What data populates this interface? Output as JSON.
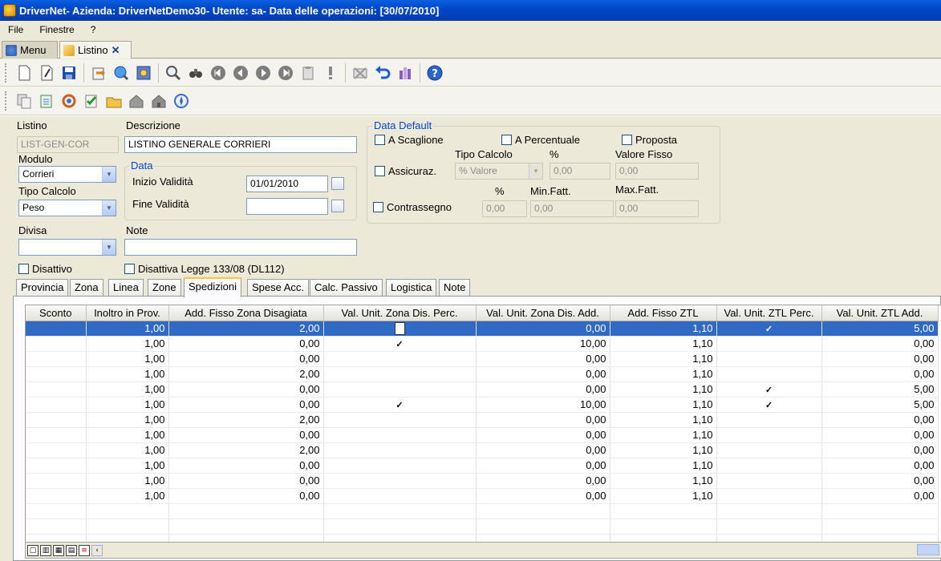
{
  "window": {
    "title": "DriverNet- Azienda: DriverNetDemo30- Utente: sa- Data delle operazioni: [30/07/2010]"
  },
  "menu": [
    "File",
    "Finestre",
    "?"
  ],
  "doc_tabs": [
    {
      "label": "Menu",
      "active": false
    },
    {
      "label": "Listino",
      "active": true
    }
  ],
  "toolbar1_icons": [
    "new-doc-icon",
    "edit-doc-icon",
    "save-icon",
    "import-icon",
    "search-globe-icon",
    "settings-icon",
    "find-icon",
    "binoculars-icon",
    "first-icon",
    "prev-icon",
    "next-icon",
    "last-icon",
    "clipboard-icon",
    "alert-icon",
    "cancel-envelope-icon",
    "undo-icon",
    "bars-icon",
    "help-icon"
  ],
  "toolbar2_icons": [
    "copy-icon",
    "export-icon",
    "refresh-icon",
    "check-list-icon",
    "open-folder-icon",
    "house-icon",
    "house-disabled-icon",
    "compass-icon"
  ],
  "form": {
    "listino_label": "Listino",
    "listino_value": "LIST-GEN-COR",
    "descrizione_label": "Descrizione",
    "descrizione_value": "LISTINO GENERALE CORRIERI",
    "modulo_label": "Modulo",
    "modulo_value": "Corrieri",
    "tipo_calcolo_label": "Tipo Calcolo",
    "tipo_calcolo_value": "Peso",
    "data_group_label": "Data",
    "inizio_validita_label": "Inizio Validità",
    "inizio_validita_value": "01/01/2010",
    "fine_validita_label": "Fine Validità",
    "fine_validita_value": "",
    "divisa_label": "Divisa",
    "divisa_value": "",
    "note_label": "Note",
    "note_value": "",
    "disattivo_label": "Disattivo",
    "disattiva_legge_label": "Disattiva Legge 133/08 (DL112)"
  },
  "data_default": {
    "group_label": "Data Default",
    "a_scaglione_label": "A Scaglione",
    "a_percentuale_label": "A Percentuale",
    "proposta_label": "Proposta",
    "tipo_calcolo_label": "Tipo Calcolo",
    "percent_label": "%",
    "valore_fisso_label": "Valore Fisso",
    "assicuraz_label": "Assicuraz.",
    "assicuraz_tipo_value": "% Valore",
    "assicuraz_percent_value": "0,00",
    "assicuraz_fisso_value": "0,00",
    "percent2_label": "%",
    "min_fatt_label": "Min.Fatt.",
    "max_fatt_label": "Max.Fatt.",
    "contrassegno_label": "Contrassegno",
    "contrassegno_percent_value": "0,00",
    "contrassegno_min_value": "0,00",
    "contrassegno_max_value": "0,00"
  },
  "inner_tabs": [
    "Provincia",
    "Zona",
    "Linea",
    "Zone",
    "Spedizioni",
    "Spese Acc.",
    "Calc. Passivo",
    "Logistica",
    "Note"
  ],
  "active_inner_tab": "Spedizioni",
  "grid": {
    "columns": [
      "Sconto",
      "Inoltro in Prov.",
      "Add. Fisso Zona Disagiata",
      "Val. Unit. Zona Dis. Perc.",
      "Val. Unit. Zona Dis. Add.",
      "Add. Fisso ZTL",
      "Val. Unit. ZTL Perc.",
      "Val. Unit. ZTL Add."
    ],
    "rows": [
      {
        "sconto": "",
        "inoltro": "1,00",
        "add_fisso_zd": "2,00",
        "zd_perc": "box",
        "zd_add": "0,00",
        "add_fisso_ztl": "1,10",
        "ztl_perc": true,
        "ztl_add": "5,00"
      },
      {
        "sconto": "",
        "inoltro": "1,00",
        "add_fisso_zd": "0,00",
        "zd_perc": true,
        "zd_add": "10,00",
        "add_fisso_ztl": "1,10",
        "ztl_perc": false,
        "ztl_add": "0,00"
      },
      {
        "sconto": "",
        "inoltro": "1,00",
        "add_fisso_zd": "0,00",
        "zd_perc": false,
        "zd_add": "0,00",
        "add_fisso_ztl": "1,10",
        "ztl_perc": false,
        "ztl_add": "0,00"
      },
      {
        "sconto": "",
        "inoltro": "1,00",
        "add_fisso_zd": "2,00",
        "zd_perc": false,
        "zd_add": "0,00",
        "add_fisso_ztl": "1,10",
        "ztl_perc": false,
        "ztl_add": "0,00"
      },
      {
        "sconto": "",
        "inoltro": "1,00",
        "add_fisso_zd": "0,00",
        "zd_perc": false,
        "zd_add": "0,00",
        "add_fisso_ztl": "1,10",
        "ztl_perc": true,
        "ztl_add": "5,00"
      },
      {
        "sconto": "",
        "inoltro": "1,00",
        "add_fisso_zd": "0,00",
        "zd_perc": true,
        "zd_add": "10,00",
        "add_fisso_ztl": "1,10",
        "ztl_perc": true,
        "ztl_add": "5,00"
      },
      {
        "sconto": "",
        "inoltro": "1,00",
        "add_fisso_zd": "2,00",
        "zd_perc": false,
        "zd_add": "0,00",
        "add_fisso_ztl": "1,10",
        "ztl_perc": false,
        "ztl_add": "0,00"
      },
      {
        "sconto": "",
        "inoltro": "1,00",
        "add_fisso_zd": "0,00",
        "zd_perc": false,
        "zd_add": "0,00",
        "add_fisso_ztl": "1,10",
        "ztl_perc": false,
        "ztl_add": "0,00"
      },
      {
        "sconto": "",
        "inoltro": "1,00",
        "add_fisso_zd": "2,00",
        "zd_perc": false,
        "zd_add": "0,00",
        "add_fisso_ztl": "1,10",
        "ztl_perc": false,
        "ztl_add": "0,00"
      },
      {
        "sconto": "",
        "inoltro": "1,00",
        "add_fisso_zd": "0,00",
        "zd_perc": false,
        "zd_add": "0,00",
        "add_fisso_ztl": "1,10",
        "ztl_perc": false,
        "ztl_add": "0,00"
      },
      {
        "sconto": "",
        "inoltro": "1,00",
        "add_fisso_zd": "0,00",
        "zd_perc": false,
        "zd_add": "0,00",
        "add_fisso_ztl": "1,10",
        "ztl_perc": false,
        "ztl_add": "0,00"
      },
      {
        "sconto": "",
        "inoltro": "1,00",
        "add_fisso_zd": "0,00",
        "zd_perc": false,
        "zd_add": "0,00",
        "add_fisso_ztl": "1,10",
        "ztl_perc": false,
        "ztl_add": "0,00"
      }
    ],
    "selected_row": 0
  },
  "colors": {
    "title_bar": "#0048c8",
    "selection": "#316ac5",
    "group_label": "#0046d5",
    "active_tab_accent": "#ffc83c"
  }
}
